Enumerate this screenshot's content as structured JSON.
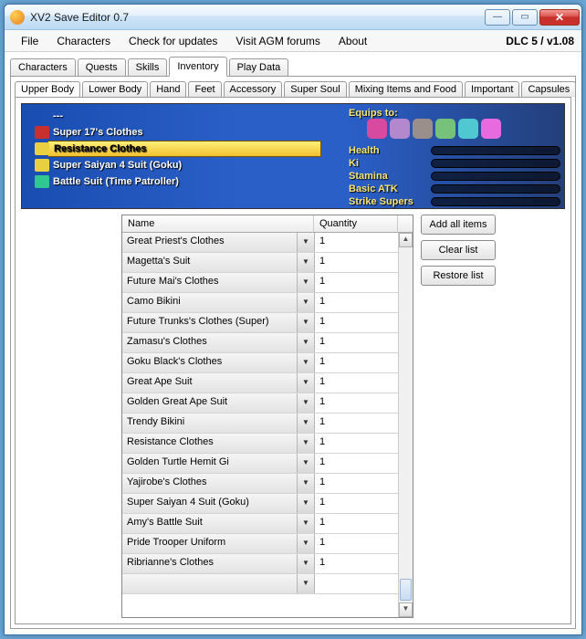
{
  "window": {
    "title": "XV2 Save Editor 0.7"
  },
  "menubar": {
    "items": [
      "File",
      "Characters",
      "Check for updates",
      "Visit AGM forums",
      "About"
    ],
    "right": "DLC 5 / v1.08"
  },
  "main_tabs": {
    "items": [
      "Characters",
      "Quests",
      "Skills",
      "Inventory",
      "Play Data"
    ],
    "active": "Inventory"
  },
  "sub_tabs": {
    "items": [
      "Upper Body",
      "Lower Body",
      "Hand",
      "Feet",
      "Accessory",
      "Super Soul",
      "Mixing Items and Food",
      "Important",
      "Capsules"
    ],
    "active": "Upper Body"
  },
  "preview": {
    "list": [
      {
        "label": "---",
        "badge": null,
        "selected": false
      },
      {
        "label": "Super 17's Clothes",
        "badge": "#c83030",
        "num": "4",
        "selected": false
      },
      {
        "label": "Resistance Clothes",
        "badge": "#e8d040",
        "num": "2",
        "selected": true
      },
      {
        "label": "Super Saiyan 4 Suit (Goku)",
        "badge": "#e8d040",
        "num": "5",
        "selected": false
      },
      {
        "label": "Battle Suit (Time Patroller)",
        "badge": "#30c890",
        "num": "1",
        "selected": false
      }
    ],
    "side_title": "Equips to:",
    "slot_colors": [
      "#d84aa0",
      "#b388cc",
      "#9a8f8a",
      "#77c27a",
      "#50c8d2",
      "#e86adf"
    ],
    "stats": [
      "Health",
      "Ki",
      "Stamina",
      "Basic ATK",
      "Strike Supers"
    ]
  },
  "grid": {
    "columns": [
      "Name",
      "Quantity"
    ],
    "rows": [
      {
        "name": "Great Priest's Clothes",
        "qty": "1"
      },
      {
        "name": "Magetta's Suit",
        "qty": "1"
      },
      {
        "name": "Future Mai's Clothes",
        "qty": "1"
      },
      {
        "name": "Camo Bikini",
        "qty": "1"
      },
      {
        "name": "Future Trunks's Clothes (Super)",
        "qty": "1"
      },
      {
        "name": "Zamasu's Clothes",
        "qty": "1"
      },
      {
        "name": "Goku Black's Clothes",
        "qty": "1"
      },
      {
        "name": "Great Ape Suit",
        "qty": "1"
      },
      {
        "name": "Golden Great Ape Suit",
        "qty": "1"
      },
      {
        "name": "Trendy Bikini",
        "qty": "1"
      },
      {
        "name": "Resistance Clothes",
        "qty": "1"
      },
      {
        "name": "Golden Turtle Hemit Gi",
        "qty": "1"
      },
      {
        "name": "Yajirobe's Clothes",
        "qty": "1"
      },
      {
        "name": "Super Saiyan 4 Suit (Goku)",
        "qty": "1"
      },
      {
        "name": "Amy's Battle Suit",
        "qty": "1"
      },
      {
        "name": "Pride Trooper Uniform",
        "qty": "1"
      },
      {
        "name": "Ribrianne's Clothes",
        "qty": "1"
      },
      {
        "name": "",
        "qty": ""
      }
    ]
  },
  "side_buttons": [
    "Add all items",
    "Clear list",
    "Restore list"
  ]
}
